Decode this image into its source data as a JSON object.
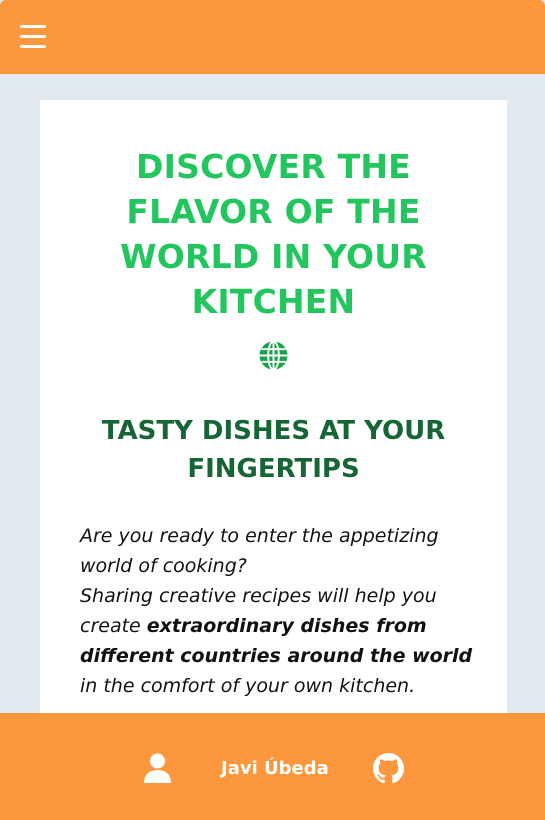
{
  "header": {
    "menu_icon": "hamburger-menu-icon",
    "background_color": "#fd973e"
  },
  "hero": {
    "title": "DISCOVER THE FLAVOR OF THE WORLD IN YOUR KITCHEN",
    "title_color": "#22c55e",
    "globe_icon": "globe-icon",
    "subtitle": "TASTY DISHES AT YOUR FINGERTIPS",
    "subtitle_color": "#166534",
    "intro_line1": "Are you ready to enter the appetizing world of cooking?",
    "intro_line2_start": "Sharing creative recipes will help you create ",
    "intro_bold": "extraordinary dishes from different countries around the world",
    "intro_line2_end": " in the comfort of your own kitchen."
  },
  "footer": {
    "background_color": "#fd973e",
    "user_icon": "user-icon",
    "author_name": "Javi Úbeda",
    "github_icon": "github-icon"
  }
}
